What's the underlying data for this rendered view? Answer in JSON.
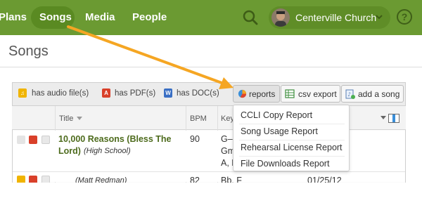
{
  "nav": {
    "items": [
      "Plans",
      "Songs",
      "Media",
      "People"
    ],
    "active": "Songs",
    "church_name": "Centerville Church",
    "help_label": "?"
  },
  "page": {
    "title": "Songs"
  },
  "filters": [
    {
      "label": "has audio file(s)",
      "icon": "audio-file-icon",
      "color": "#f0b400"
    },
    {
      "label": "has PDF(s)",
      "icon": "pdf-icon",
      "color": "#d9402a"
    },
    {
      "label": "has DOC(s)",
      "icon": "doc-icon",
      "color": "#3a6fc4"
    }
  ],
  "toolbar": {
    "reports_label": "reports",
    "csv_label": "csv export",
    "add_label": "add a song"
  },
  "table": {
    "columns": [
      "Title",
      "BPM",
      "Key"
    ],
    "rows": [
      {
        "title": "10,000 Reasons (Bless The",
        "title2": "Lord)",
        "arrangement": "(High School)",
        "bpm": "90",
        "key_line1": "G–",
        "key_line2": "Gm",
        "key_line3": "A, E"
      },
      {
        "title": "",
        "author": "(Matt Redman)",
        "bpm": "82",
        "key_line1": "Bb, F",
        "date": "01/25/12"
      }
    ]
  },
  "reports_menu": {
    "items": [
      "CCLI Copy Report",
      "Song Usage Report",
      "Rehearsal License Report",
      "File Downloads Report"
    ]
  },
  "colors": {
    "nav_green": "#6b9a32",
    "annotation_arrow": "#f5a623",
    "title_green": "#4d6b1c"
  }
}
